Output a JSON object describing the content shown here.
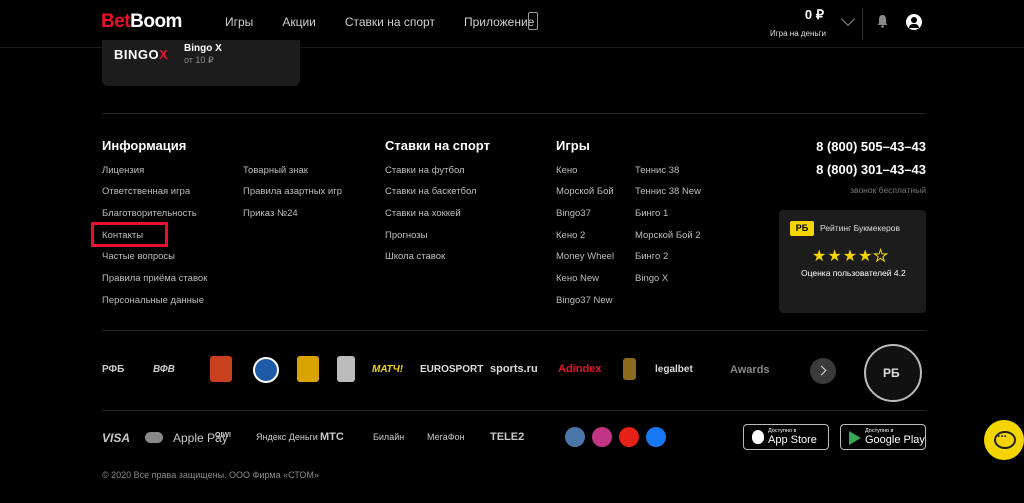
{
  "header": {
    "logo_part1": "Bet",
    "logo_part2": "Boom",
    "nav": [
      "Игры",
      "Акции",
      "Ставки на спорт",
      "Приложение"
    ],
    "balance_amount": "0 ₽",
    "balance_label": "Игра на деньги"
  },
  "bingo_card": {
    "logo": "BINGO",
    "logo_x": "X",
    "title": "Bingo X",
    "subtitle": "от 10 ₽"
  },
  "info": {
    "title": "Информация",
    "col1": [
      "Лицензия",
      "Ответственная игра",
      "Благотворительность",
      "Контакты",
      "Частые вопросы",
      "Правила приёма ставок",
      "Персональные данные"
    ],
    "col2": [
      "Товарный знак",
      "Правила азартных игр",
      "Приказ №24"
    ]
  },
  "sports": {
    "title": "Ставки на спорт",
    "links": [
      "Ставки на футбол",
      "Ставки на баскетбол",
      "Ставки на хоккей",
      "Прогнозы",
      "Школа ставок"
    ]
  },
  "games": {
    "title": "Игры",
    "col1": [
      "Кено",
      "Морской Бой",
      "Bingo37",
      "Кено 2",
      "Money Wheel",
      "Кено New",
      "Bingo37 New"
    ],
    "col2": [
      "Теннис 38",
      "Теннис 38 New",
      "Бинго 1",
      "Морской Бой 2",
      "Бинго 2",
      "Bingo X"
    ]
  },
  "contacts": {
    "phone1": "8 (800) 505–43–43",
    "phone2": "8 (800) 301–43–43",
    "free_call": "звонок бесплатный"
  },
  "rating": {
    "badge": "РБ",
    "title": "Рейтинг Букмекеров",
    "stars_filled": 4,
    "stars_total": 5,
    "score_text": "Оценка пользователей 4.2"
  },
  "partners": [
    "РФБ",
    "ВФВ",
    "УРАЛ",
    "Оренбург",
    "Арсенал",
    "Уфа",
    "МАТЧ!",
    "EUROSPORT",
    "sports.ru",
    "Adindex",
    "Уфа",
    "legalbet",
    "Awards"
  ],
  "payments": [
    "VISA",
    "Mastercard",
    "Apple Pay",
    "QIWI",
    "Яндекс Деньги",
    "МТС",
    "Билайн",
    "МегаФон",
    "TELE2"
  ],
  "socials": [
    "vk-icon",
    "instagram-icon",
    "youtube-icon",
    "facebook-icon"
  ],
  "stores": {
    "appstore_small": "Доступно в",
    "appstore_name": "App Store",
    "gplay_small": "Доступно в",
    "gplay_name": "Google Play"
  },
  "copyright": "© 2020 Все права защищены. ООО Фирма «СТОМ»",
  "colors": {
    "brand_red": "#e8102a",
    "accent_yellow": "#f4d500",
    "background": "#000000"
  }
}
